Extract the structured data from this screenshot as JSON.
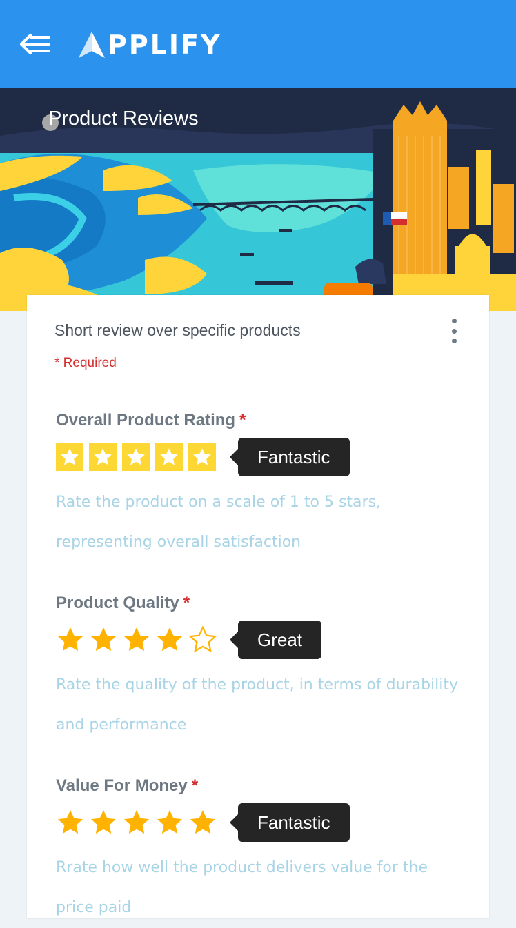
{
  "header": {
    "back_icon": "back-menu-icon",
    "logo_text": "PPLIFY",
    "logo_icon": "applify-a-icon",
    "bg_color": "#2b93ee"
  },
  "hero": {
    "title": "Product Reviews"
  },
  "form": {
    "description": "Short review over specific products",
    "more_icon": "more-vert-icon",
    "required_note": "* Required",
    "questions": [
      {
        "label": "Overall Product Rating",
        "required_mark": "*",
        "style": "boxed-stars",
        "rating": 5,
        "max": 5,
        "rating_label": "Fantastic",
        "help": "Rate the product on a scale of 1 to 5 stars, representing overall satisfaction"
      },
      {
        "label": "Product Quality",
        "required_mark": "*",
        "style": "plain-stars",
        "rating": 4,
        "max": 5,
        "rating_label": "Great",
        "help": "Rate the quality of the product, in terms of durability and performance"
      },
      {
        "label": "Value For Money",
        "required_mark": "*",
        "style": "plain-stars",
        "rating": 5,
        "max": 5,
        "rating_label": "Fantastic",
        "help": "Rrate how well the product delivers value for the price paid"
      }
    ]
  },
  "colors": {
    "star_filled": "#ffb300",
    "star_box": "#fdd835",
    "required": "#d32f2f",
    "help_text": "#a8d4e6"
  }
}
